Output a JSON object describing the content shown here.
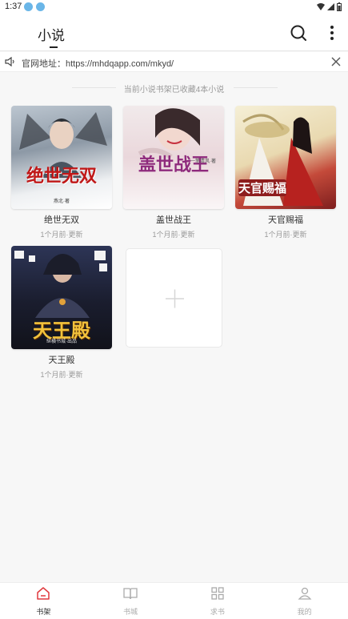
{
  "status_bar": {
    "time": "1:37"
  },
  "header": {
    "title": "小说"
  },
  "notice": {
    "label": "官网地址：",
    "url": "https://mhdqapp.com/mkyd/"
  },
  "shelf": {
    "summary": "当前小说书架已收藏4本小说"
  },
  "books": [
    {
      "name": "绝世无双",
      "updated": "1个月前·更新",
      "cover_title": "绝世无双",
      "cover_author": "燕北·著"
    },
    {
      "name": "盖世战王",
      "updated": "1个月前·更新",
      "cover_title": "盖世战王",
      "cover_author": "一笔清风·著"
    },
    {
      "name": "天官赐福",
      "updated": "1个月前·更新",
      "cover_title": "天官赐福"
    },
    {
      "name": "天王殿",
      "updated": "1个月前·更新",
      "cover_title": "天王殿",
      "cover_subtitle": "纵横书城·出品"
    }
  ],
  "nav": {
    "items": [
      {
        "label": "书架",
        "icon": "bookshelf-icon",
        "active": true
      },
      {
        "label": "书城",
        "icon": "open-book-icon",
        "active": false
      },
      {
        "label": "求书",
        "icon": "grid-icon",
        "active": false
      },
      {
        "label": "我的",
        "icon": "user-icon",
        "active": false
      }
    ]
  },
  "colors": {
    "accent": "#e0393e",
    "inactive": "#aaaaaa"
  }
}
